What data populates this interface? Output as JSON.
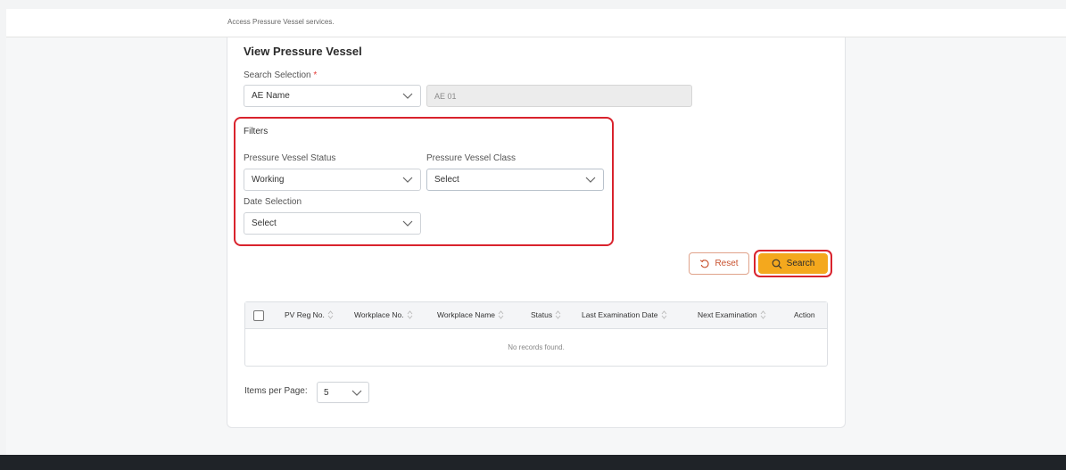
{
  "header": {
    "subtitle": "Access Pressure Vessel services."
  },
  "page": {
    "title": "View Pressure Vessel"
  },
  "search_selection": {
    "label": "Search Selection",
    "required_mark": "*",
    "selected": "AE Name",
    "value": "AE 01"
  },
  "filters": {
    "title": "Filters",
    "status": {
      "label": "Pressure Vessel Status",
      "selected": "Working"
    },
    "class": {
      "label": "Pressure Vessel Class",
      "selected": "Select"
    },
    "date": {
      "label": "Date Selection",
      "selected": "Select"
    }
  },
  "actions": {
    "reset_label": "Reset",
    "search_label": "Search"
  },
  "table": {
    "columns": [
      "PV Reg No.",
      "Workplace No.",
      "Workplace Name",
      "Status",
      "Last Examination Date",
      "Next Examination",
      "Action"
    ],
    "empty_message": "No records found."
  },
  "pagination": {
    "label": "Items per Page:",
    "selected": "5"
  },
  "colors": {
    "accent": "#f4a81d",
    "highlight": "#d9232d",
    "reset_text": "#c8502d"
  }
}
